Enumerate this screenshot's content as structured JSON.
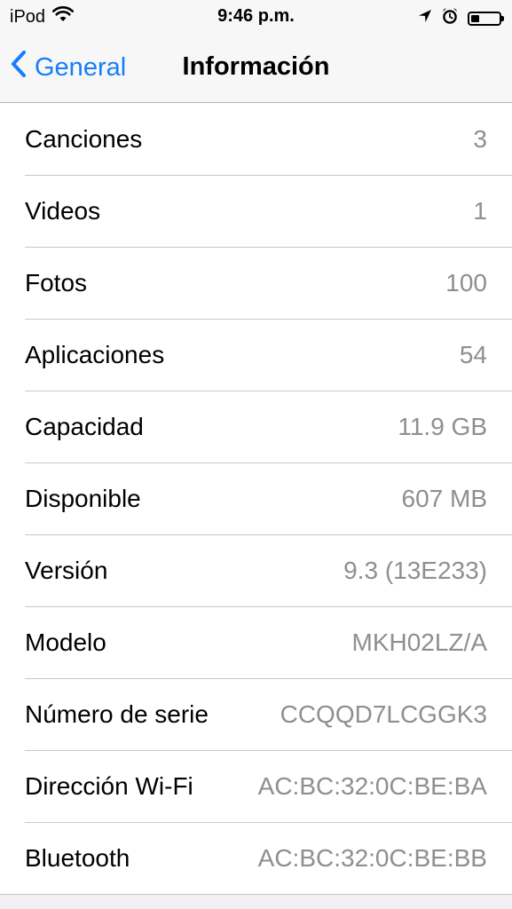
{
  "status_bar": {
    "carrier": "iPod",
    "time": "9:46 p.m.",
    "battery_level": 0.3,
    "icons": [
      "wifi-icon",
      "location-arrow-icon",
      "alarm-clock-icon",
      "battery-icon"
    ]
  },
  "nav": {
    "back_label": "General",
    "title": "Información"
  },
  "info_rows": [
    {
      "label": "Canciones",
      "value": "3"
    },
    {
      "label": "Videos",
      "value": "1"
    },
    {
      "label": "Fotos",
      "value": "100"
    },
    {
      "label": "Aplicaciones",
      "value": "54"
    },
    {
      "label": "Capacidad",
      "value": "11.9 GB"
    },
    {
      "label": "Disponible",
      "value": "607 MB"
    },
    {
      "label": "Versión",
      "value": "9.3 (13E233)"
    },
    {
      "label": "Modelo",
      "value": "MKH02LZ/A"
    },
    {
      "label": "Número de serie",
      "value": "CCQQD7LCGGK3"
    },
    {
      "label": "Dirección Wi-Fi",
      "value": "AC:BC:32:0C:BE:BA"
    },
    {
      "label": "Bluetooth",
      "value": "AC:BC:32:0C:BE:BB"
    }
  ],
  "colors": {
    "accent": "#157efb",
    "secondary_text": "#8e8e93",
    "background": "#efeff4"
  }
}
